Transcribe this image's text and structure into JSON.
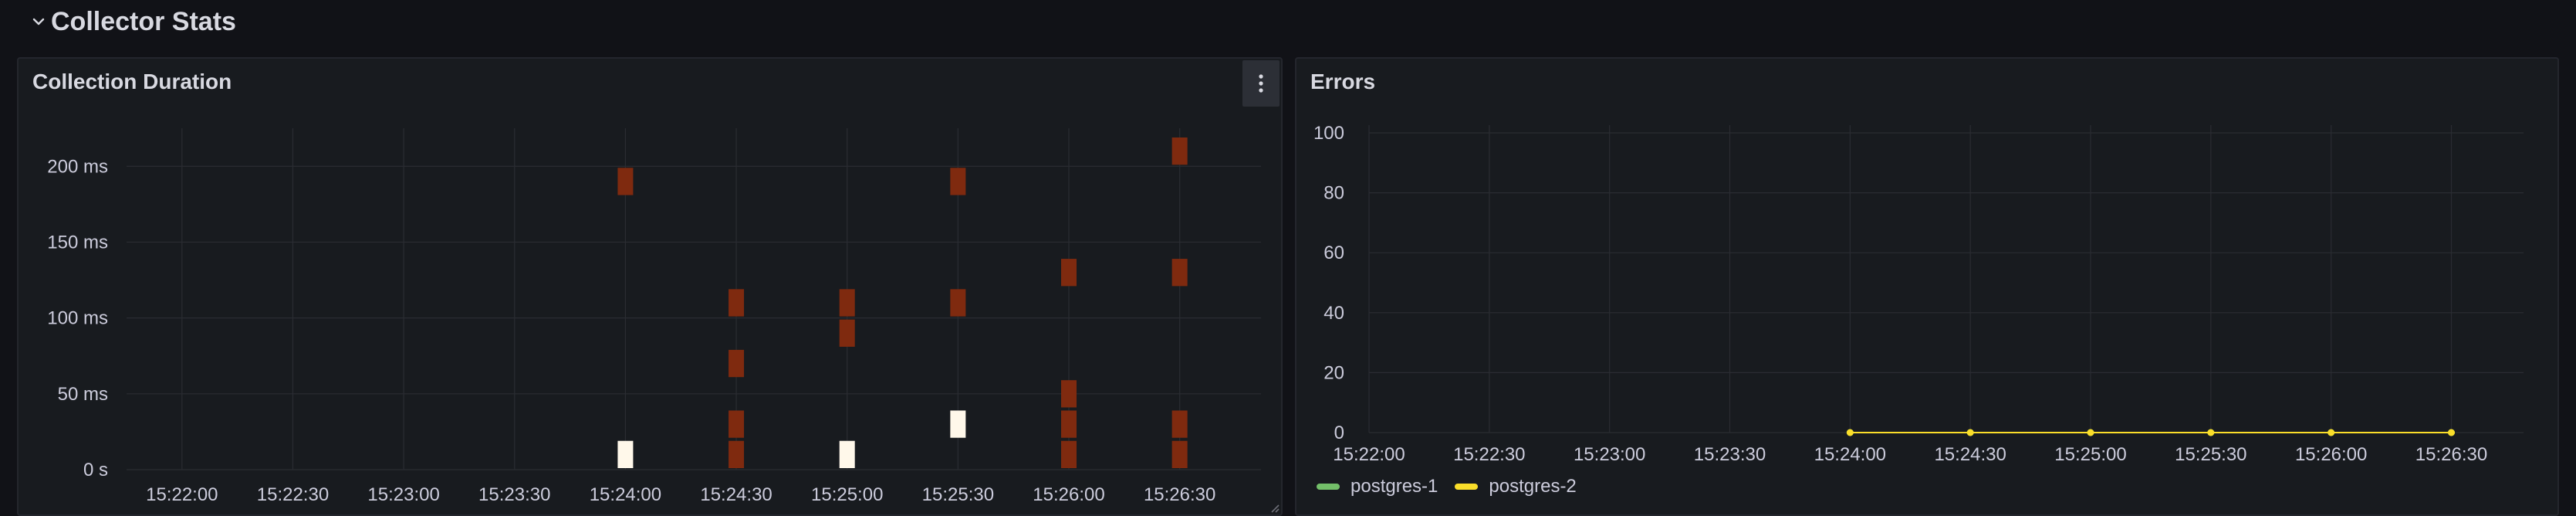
{
  "row": {
    "title": "Collector Stats"
  },
  "colors": {
    "background": "#111217",
    "panel_bg": "#181b1f",
    "grid": "#2a2c32",
    "heat_low": "#7f2a0f",
    "heat_high": "#fff8ea",
    "series_green": "#73bf69",
    "series_yellow": "#fade2a"
  },
  "icons": {
    "chevron": "chevron-down-icon",
    "menu": "kebab-menu-icon",
    "resize": "resize-handle-icon"
  },
  "panels": {
    "duration": {
      "title": "Collection Duration"
    },
    "errors": {
      "title": "Errors"
    }
  },
  "chart_data": [
    {
      "type": "heatmap",
      "title": "Collection Duration",
      "x_ticks": [
        "15:22:00",
        "15:22:30",
        "15:23:00",
        "15:23:30",
        "15:24:00",
        "15:24:30",
        "15:25:00",
        "15:25:30",
        "15:26:00",
        "15:26:30"
      ],
      "y_ticks": [
        "0 s",
        "50 ms",
        "100 ms",
        "150 ms",
        "200 ms"
      ],
      "y_tick_values_ms": [
        0,
        50,
        100,
        150,
        200
      ],
      "xlim": [
        "15:21:45",
        "15:26:52"
      ],
      "ylim_ms": [
        0,
        220
      ],
      "bucket_size_ms": 20,
      "cells": [
        {
          "x": "15:24:00",
          "y_ms": 10,
          "level": "high"
        },
        {
          "x": "15:24:00",
          "y_ms": 190,
          "level": "low"
        },
        {
          "x": "15:24:30",
          "y_ms": 10,
          "level": "low"
        },
        {
          "x": "15:24:30",
          "y_ms": 30,
          "level": "low"
        },
        {
          "x": "15:24:30",
          "y_ms": 70,
          "level": "low"
        },
        {
          "x": "15:24:30",
          "y_ms": 110,
          "level": "low"
        },
        {
          "x": "15:25:00",
          "y_ms": 10,
          "level": "high"
        },
        {
          "x": "15:25:00",
          "y_ms": 90,
          "level": "low"
        },
        {
          "x": "15:25:00",
          "y_ms": 110,
          "level": "low"
        },
        {
          "x": "15:25:30",
          "y_ms": 30,
          "level": "high"
        },
        {
          "x": "15:25:30",
          "y_ms": 110,
          "level": "low"
        },
        {
          "x": "15:25:30",
          "y_ms": 190,
          "level": "low"
        },
        {
          "x": "15:26:00",
          "y_ms": 10,
          "level": "low"
        },
        {
          "x": "15:26:00",
          "y_ms": 30,
          "level": "low"
        },
        {
          "x": "15:26:00",
          "y_ms": 50,
          "level": "low"
        },
        {
          "x": "15:26:00",
          "y_ms": 130,
          "level": "low"
        },
        {
          "x": "15:26:30",
          "y_ms": 10,
          "level": "low"
        },
        {
          "x": "15:26:30",
          "y_ms": 30,
          "level": "low"
        },
        {
          "x": "15:26:30",
          "y_ms": 130,
          "level": "low"
        },
        {
          "x": "15:26:30",
          "y_ms": 210,
          "level": "low"
        }
      ],
      "grid": true
    },
    {
      "type": "line",
      "title": "Errors",
      "x_ticks": [
        "15:22:00",
        "15:22:30",
        "15:23:00",
        "15:23:30",
        "15:24:00",
        "15:24:30",
        "15:25:00",
        "15:25:30",
        "15:26:00",
        "15:26:30"
      ],
      "y_ticks": [
        "0",
        "20",
        "40",
        "60",
        "80",
        "100"
      ],
      "y_tick_values": [
        0,
        20,
        40,
        60,
        80,
        100
      ],
      "xlim": [
        "15:22:00",
        "15:26:48"
      ],
      "ylim": [
        0,
        100
      ],
      "series": [
        {
          "name": "postgres-1",
          "color": "#73bf69",
          "x": [
            "15:24:00",
            "15:24:30",
            "15:25:00",
            "15:25:30",
            "15:26:00",
            "15:26:30"
          ],
          "values": [
            0,
            0,
            0,
            0,
            0,
            0
          ]
        },
        {
          "name": "postgres-2",
          "color": "#fade2a",
          "x": [
            "15:24:00",
            "15:24:30",
            "15:25:00",
            "15:25:30",
            "15:26:00",
            "15:26:30"
          ],
          "values": [
            0,
            0,
            0,
            0,
            0,
            0
          ]
        }
      ],
      "legend": "bottom-left",
      "grid": true
    }
  ]
}
